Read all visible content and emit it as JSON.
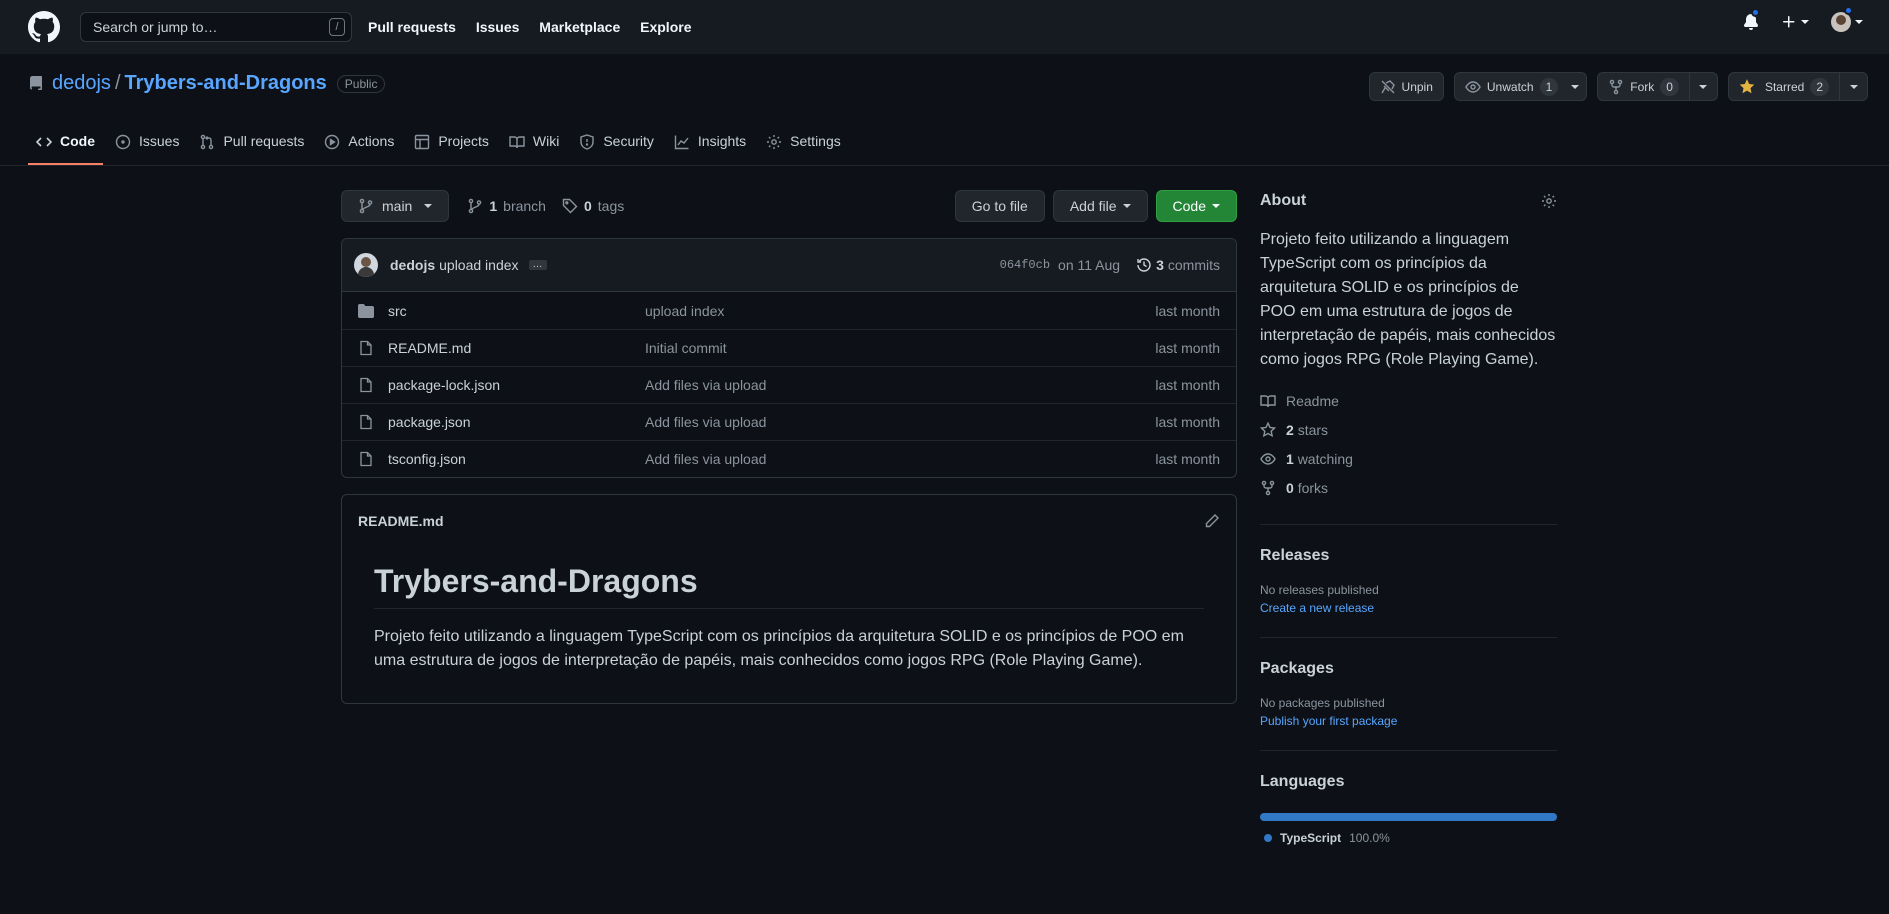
{
  "header": {
    "search_placeholder": "Search or jump to…",
    "search_key": "/",
    "nav": [
      "Pull requests",
      "Issues",
      "Marketplace",
      "Explore"
    ]
  },
  "repo": {
    "owner": "dedojs",
    "sep": "/",
    "name": "Trybers-and-Dragons",
    "visibility": "Public"
  },
  "actions": {
    "unpin": "Unpin",
    "unwatch": "Unwatch",
    "unwatch_count": "1",
    "fork": "Fork",
    "fork_count": "0",
    "starred": "Starred",
    "star_count": "2"
  },
  "tabs": [
    "Code",
    "Issues",
    "Pull requests",
    "Actions",
    "Projects",
    "Wiki",
    "Security",
    "Insights",
    "Settings"
  ],
  "branch": {
    "name": "main",
    "branch_count": "1",
    "branch_label": "branch",
    "tag_count": "0",
    "tag_label": "tags",
    "goto": "Go to file",
    "add": "Add file",
    "code": "Code"
  },
  "commit": {
    "author": "dedojs",
    "message": "upload index",
    "ellipsis": "…",
    "sha": "064f0cb",
    "date": "on 11 Aug",
    "count": "3",
    "count_label": "commits"
  },
  "files": [
    {
      "type": "folder",
      "name": "src",
      "message": "upload index",
      "age": "last month"
    },
    {
      "type": "file",
      "name": "README.md",
      "message": "Initial commit",
      "age": "last month"
    },
    {
      "type": "file",
      "name": "package-lock.json",
      "message": "Add files via upload",
      "age": "last month"
    },
    {
      "type": "file",
      "name": "package.json",
      "message": "Add files via upload",
      "age": "last month"
    },
    {
      "type": "file",
      "name": "tsconfig.json",
      "message": "Add files via upload",
      "age": "last month"
    }
  ],
  "readme": {
    "filename": "README.md",
    "title": "Trybers-and-Dragons",
    "body": "Projeto feito utilizando a linguagem TypeScript com os princípios da arquitetura SOLID e os princípios de POO em uma estrutura de jogos de interpretação de papéis, mais conhecidos como jogos RPG (Role Playing Game)."
  },
  "about": {
    "title": "About",
    "description": "Projeto feito utilizando a linguagem TypeScript com os princípios da arquitetura SOLID e os princípios de POO em uma estrutura de jogos de interpretação de papéis, mais conhecidos como jogos RPG (Role Playing Game).",
    "readme": "Readme",
    "stars_count": "2",
    "stars": "stars",
    "watching_count": "1",
    "watching": "watching",
    "forks_count": "0",
    "forks": "forks"
  },
  "releases": {
    "title": "Releases",
    "none": "No releases published",
    "link": "Create a new release"
  },
  "packages": {
    "title": "Packages",
    "none": "No packages published",
    "link": "Publish your first package"
  },
  "languages": {
    "title": "Languages",
    "name": "TypeScript",
    "percent": "100.0%",
    "fraction": 1.0,
    "color": "#3178c6"
  }
}
